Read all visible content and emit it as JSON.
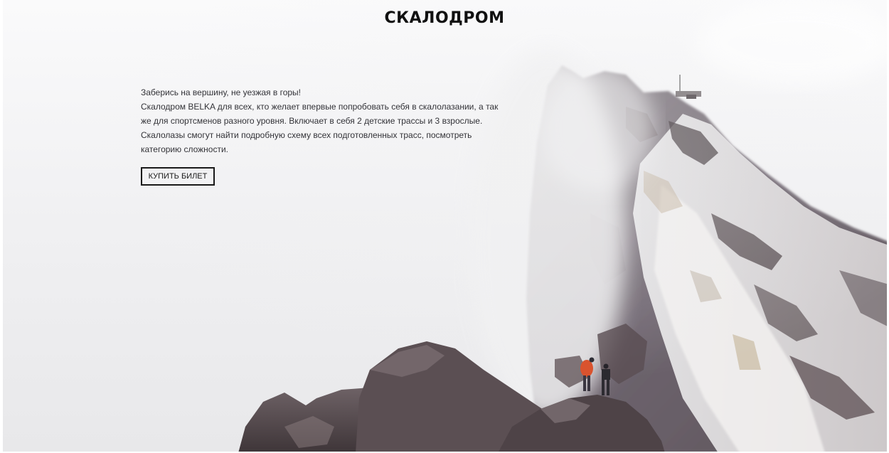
{
  "page": {
    "title": "СКАЛОДРОМ"
  },
  "intro": {
    "line1": "Заберись на вершину, не уезжая в горы!",
    "line2": "Скалодром BELKA для всех, кто желает впервые попробовать себя в скалолазании, а так же для спортсменов разного уровня. Включает в себя 2 детские трассы и 3 взрослые. Скалолазы смогут найти подробную схему всех подготовленных трасс, посмотреть категорию сложности."
  },
  "cta": {
    "buy_label": "КУПИТЬ БИЛЕТ"
  },
  "colors": {
    "title": "#111111",
    "body_text": "#333338",
    "button_border": "#1a1a1a",
    "climber_jacket": "#d9532e"
  }
}
